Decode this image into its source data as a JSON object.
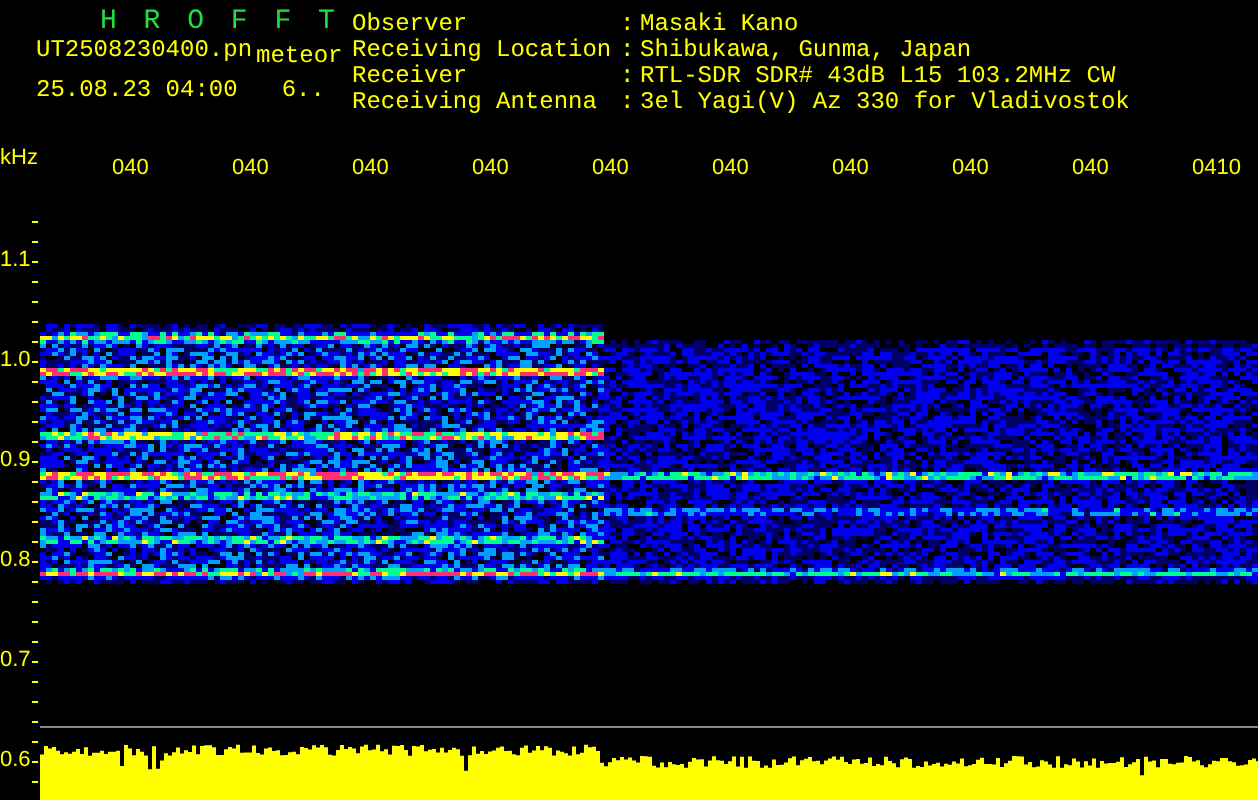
{
  "header": {
    "title": "H R O F F T",
    "filename": "UT2508230400.pn",
    "mode": "meteor",
    "timestamp": "25.08.23 04:00",
    "count": "6..",
    "info": [
      {
        "label": "Observer",
        "separator": ":",
        "value": "Masaki Kano"
      },
      {
        "label": "Receiving Location",
        "separator": ":",
        "value": "Shibukawa, Gunma, Japan"
      },
      {
        "label": "Receiver",
        "separator": ":",
        "value": "RTL-SDR SDR# 43dB L15 103.2MHz CW"
      },
      {
        "label": "Receiving Antenna",
        "separator": ":",
        "value": "3el Yagi(V) Az 330 for Vladivostok"
      }
    ]
  },
  "plot": {
    "unit": "kHz",
    "time_labels": [
      "040",
      "040",
      "040",
      "040",
      "040",
      "040",
      "040",
      "040",
      "040",
      "0410"
    ],
    "frequency_labels": [
      "1.1",
      "1.0",
      "0.9",
      "0.8",
      "0.7",
      "0.6"
    ]
  }
}
